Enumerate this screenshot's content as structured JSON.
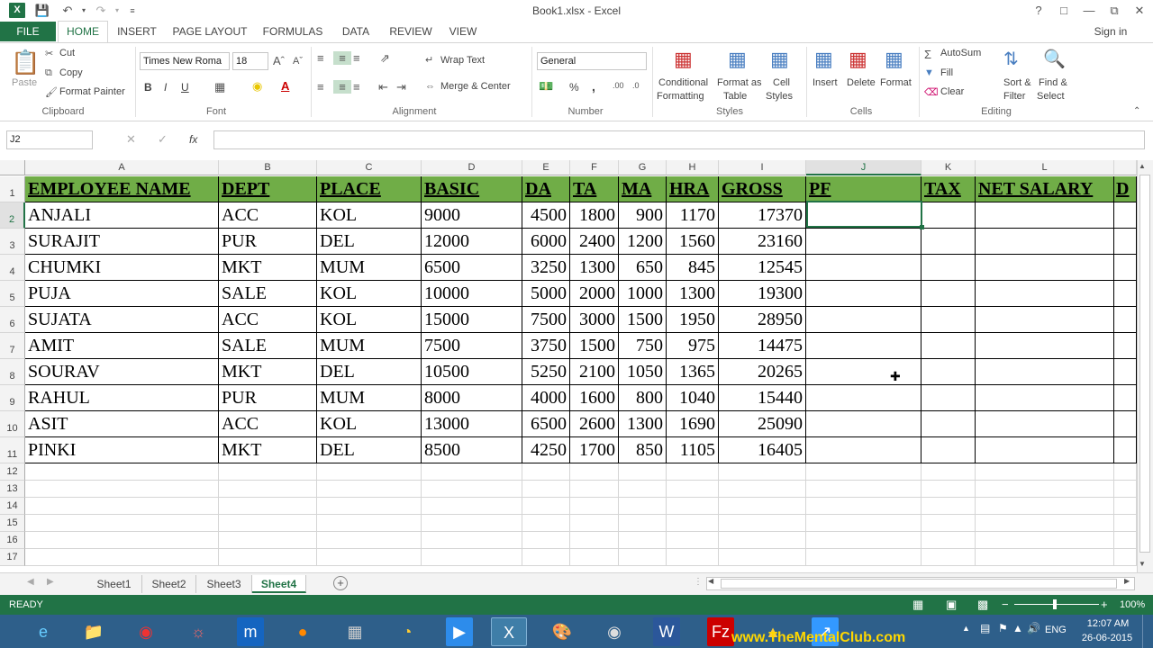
{
  "window": {
    "title": "Book1.xlsx - Excel",
    "help": "?",
    "signin": "Sign in"
  },
  "tabs": [
    "FILE",
    "HOME",
    "INSERT",
    "PAGE LAYOUT",
    "FORMULAS",
    "DATA",
    "REVIEW",
    "VIEW"
  ],
  "ribbon": {
    "clipboard": {
      "paste": "Paste",
      "cut": "Cut",
      "copy": "Copy",
      "format_painter": "Format Painter",
      "label": "Clipboard"
    },
    "font": {
      "name": "Times New Roma",
      "size": "18",
      "bold": "B",
      "italic": "I",
      "underline": "U",
      "label": "Font"
    },
    "alignment": {
      "wrap": "Wrap Text",
      "merge": "Merge & Center",
      "label": "Alignment"
    },
    "number": {
      "format": "General",
      "percent": "%",
      "comma": ",",
      "label": "Number"
    },
    "styles": {
      "cond": "Conditional",
      "cond2": "Formatting",
      "fat": "Format as",
      "fat2": "Table",
      "cell": "Cell",
      "cell2": "Styles",
      "label": "Styles"
    },
    "cells": {
      "insert": "Insert",
      "delete": "Delete",
      "format": "Format",
      "label": "Cells"
    },
    "editing": {
      "autosum": "AutoSum",
      "fill": "Fill",
      "clear": "Clear",
      "sort": "Sort &",
      "sort2": "Filter",
      "find": "Find &",
      "find2": "Select",
      "label": "Editing"
    }
  },
  "formula_bar": {
    "name_box": "J2",
    "fx": "fx",
    "value": ""
  },
  "columns": [
    {
      "id": "A",
      "selected": false
    },
    {
      "id": "B",
      "selected": false
    },
    {
      "id": "C",
      "selected": false
    },
    {
      "id": "D",
      "selected": false
    },
    {
      "id": "E",
      "selected": false
    },
    {
      "id": "F",
      "selected": false
    },
    {
      "id": "G",
      "selected": false
    },
    {
      "id": "H",
      "selected": false
    },
    {
      "id": "I",
      "selected": false
    },
    {
      "id": "J",
      "selected": true
    },
    {
      "id": "K",
      "selected": false
    },
    {
      "id": "L",
      "selected": false
    }
  ],
  "headers": [
    "EMPLOYEE NAME",
    "DEPT",
    "PLACE",
    "BASIC",
    "DA",
    "TA",
    "MA",
    "HRA",
    "GROSS",
    "PF",
    "TAX",
    "NET SALARY",
    "D"
  ],
  "rows": [
    [
      "ANJALI",
      "ACC",
      "KOL",
      "9000",
      "4500",
      "1800",
      "900",
      "1170",
      "17370"
    ],
    [
      "SURAJIT",
      "PUR",
      "DEL",
      "12000",
      "6000",
      "2400",
      "1200",
      "1560",
      "23160"
    ],
    [
      "CHUMKI",
      "MKT",
      "MUM",
      "6500",
      "3250",
      "1300",
      "650",
      "845",
      "12545"
    ],
    [
      "PUJA",
      "SALE",
      "KOL",
      "10000",
      "5000",
      "2000",
      "1000",
      "1300",
      "19300"
    ],
    [
      "SUJATA",
      "ACC",
      "KOL",
      "15000",
      "7500",
      "3000",
      "1500",
      "1950",
      "28950"
    ],
    [
      "AMIT",
      "SALE",
      "MUM",
      "7500",
      "3750",
      "1500",
      "750",
      "975",
      "14475"
    ],
    [
      "SOURAV",
      "MKT",
      "DEL",
      "10500",
      "5250",
      "2100",
      "1050",
      "1365",
      "20265"
    ],
    [
      "RAHUL",
      "PUR",
      "MUM",
      "8000",
      "4000",
      "1600",
      "800",
      "1040",
      "15440"
    ],
    [
      "ASIT",
      "ACC",
      "KOL",
      "13000",
      "6500",
      "2600",
      "1300",
      "1690",
      "25090"
    ],
    [
      "PINKI",
      "MKT",
      "DEL",
      "8500",
      "4250",
      "1700",
      "850",
      "1105",
      "16405"
    ]
  ],
  "row_numbers": [
    "1",
    "2",
    "3",
    "4",
    "5",
    "6",
    "7",
    "8",
    "9",
    "10",
    "11",
    "12",
    "13",
    "14",
    "15",
    "16",
    "17"
  ],
  "sheets": [
    {
      "name": "Sheet1",
      "active": false
    },
    {
      "name": "Sheet2",
      "active": false
    },
    {
      "name": "Sheet3",
      "active": false
    },
    {
      "name": "Sheet4",
      "active": true
    }
  ],
  "status": {
    "mode": "READY",
    "zoom": "100%"
  },
  "taskbar": {
    "lang": "ENG",
    "time": "12:07 AM",
    "date": "26-06-2015",
    "watermark": "www.TheMentalClub.com"
  },
  "colors": {
    "excel_green": "#217346",
    "header_fill": "#70ad47",
    "taskbar": "#2e5f8a"
  }
}
